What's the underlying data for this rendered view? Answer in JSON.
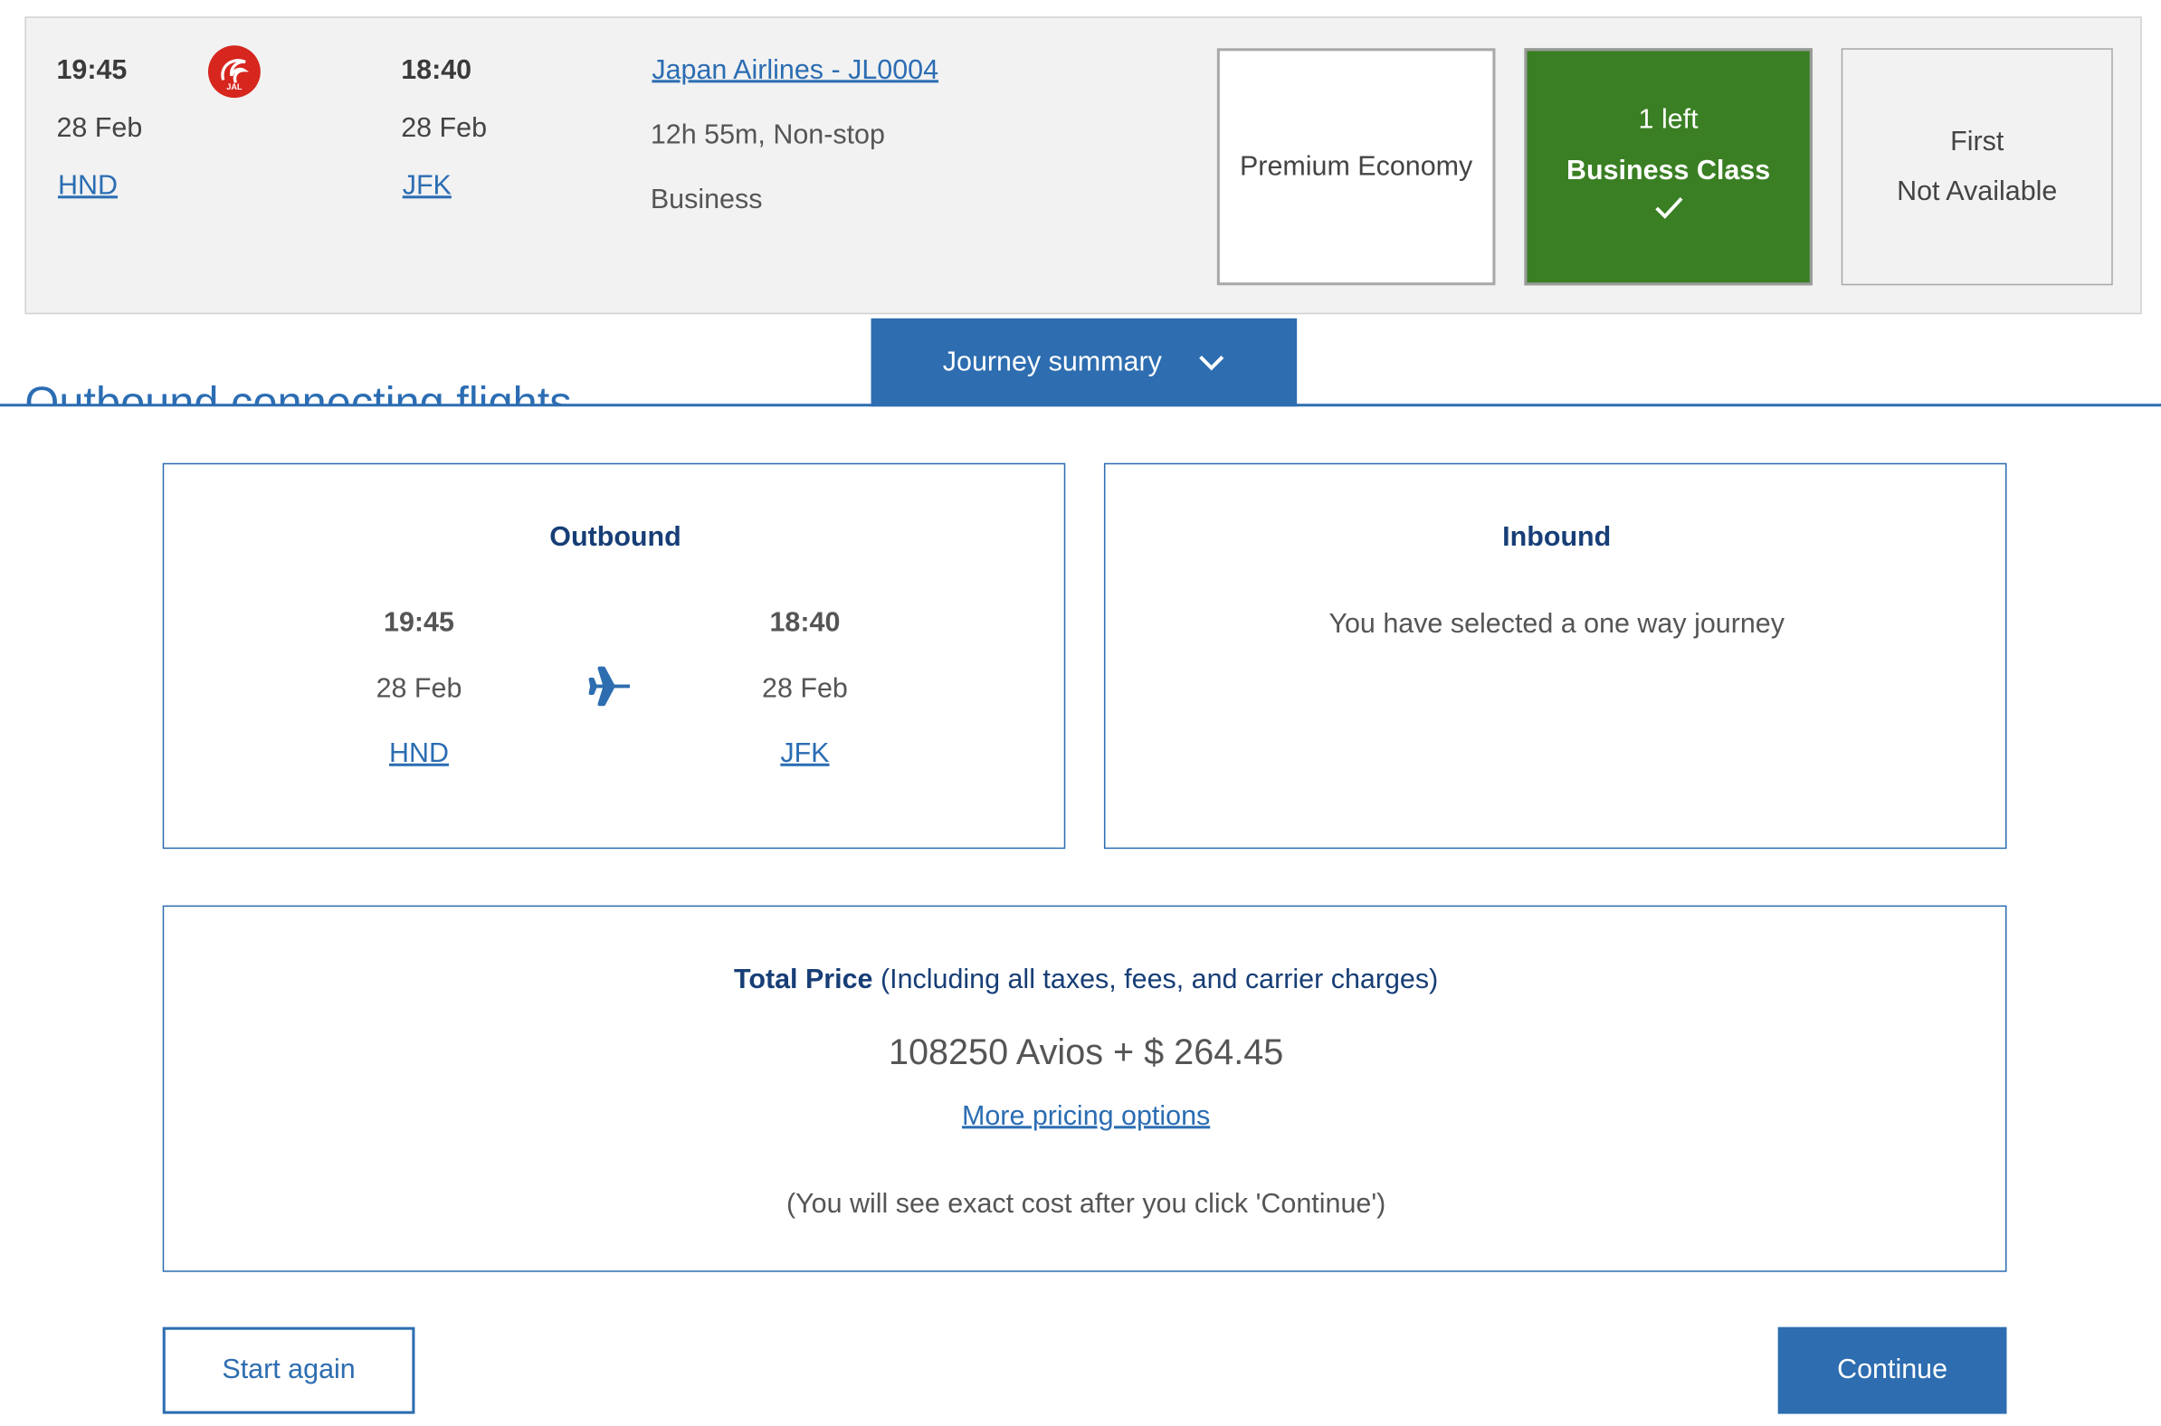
{
  "flight": {
    "departure": {
      "time": "19:45",
      "date": "28 Feb",
      "airport": "HND"
    },
    "arrival": {
      "time": "18:40",
      "date": "28 Feb",
      "airport": "JFK"
    },
    "airline_link": "Japan Airlines - JL0004",
    "duration": "12h 55m, Non-stop",
    "cabin": "Business",
    "logo_text": "JAL"
  },
  "cabins": {
    "premium_economy": {
      "label": "Premium Economy"
    },
    "business": {
      "availability": "1 left",
      "label": "Business Class",
      "check_icon": "checkmark-icon"
    },
    "first": {
      "label": "First",
      "status": "Not Available"
    }
  },
  "summary_tab": {
    "label": "Journey summary",
    "chevron_icon": "chevron-down-icon"
  },
  "section_heading": "Outbound connecting flights",
  "outbound": {
    "title": "Outbound",
    "departure": {
      "time": "19:45",
      "date": "28 Feb",
      "airport": "HND"
    },
    "arrival": {
      "time": "18:40",
      "date": "28 Feb",
      "airport": "JFK"
    },
    "plane_icon": "airplane-icon"
  },
  "inbound": {
    "title": "Inbound",
    "message": "You have selected a one way journey"
  },
  "price": {
    "label": "Total Price",
    "note": "(Including all taxes, fees, and carrier charges)",
    "amount": "108250 Avios + $ 264.45",
    "more_options": "More pricing options",
    "disclaimer": "(You will see exact cost after you click 'Continue')"
  },
  "actions": {
    "start_again": "Start again",
    "continue": "Continue"
  },
  "colors": {
    "primary": "#2d6db0",
    "selected_green": "#3a7f23",
    "title_navy": "#173e76",
    "jal_red": "#d6261e"
  }
}
